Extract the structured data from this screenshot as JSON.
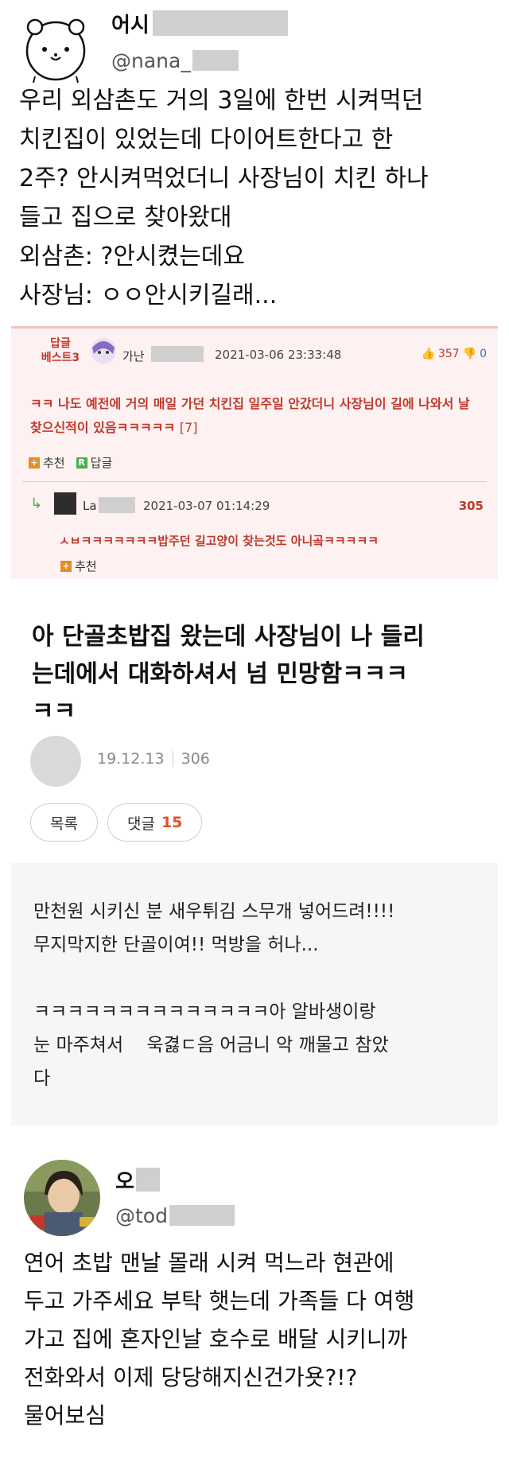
{
  "tweet1": {
    "name": "어시",
    "handle": "@nana_",
    "lines": [
      "우리 외삼촌도 거의 3일에 한번 시켜먹던",
      "치킨집이 있었는데 다이어트한다고 한",
      "2주? 안시켜먹었더니 사장님이 치킨 하나",
      "들고 집으로 찾아왔대",
      "외삼촌: ?안시켰는데요",
      "사장님: ㅇㅇ안시키길래..."
    ]
  },
  "comment": {
    "best_label": "답글\n베스트3",
    "author": "가난",
    "date": "2021-03-06 23:33:48",
    "likes": "357",
    "dislikes": "0",
    "text": "ㅋㅋ 나도 예전에 거의 매일 가던 치킨집 일주일 안갔더니 사장님이 길에 나와서 날 찾으신적이 있음ㅋㅋㅋㅋㅋ",
    "reply_count": "[7]",
    "recommend_label": "추천",
    "reply_label": "답글",
    "reply": {
      "author": "La",
      "date": "2021-03-07 01:14:29",
      "likes": "305",
      "text": "ㅅㅂㅋㅋㅋㅋㅋㅋㅋ밥주던 길고양이 찾는것도 아니곸ㅋㅋㅋㅋㅋ",
      "recommend_label": "추천"
    }
  },
  "post": {
    "title_lines": [
      "아 단골초밥집 왔는데 사장님이 나 들리",
      "는데에서 대화하셔서 넘 민망함ㅋㅋㅋ",
      "ㅋㅋ"
    ],
    "date": "19.12.13",
    "views": "306",
    "list_label": "목록",
    "comments_label": "댓글",
    "comments_count": "15"
  },
  "message": {
    "lines": [
      "만천원 시키신 분 새우튀김 스무개 넣어드려!!!!",
      "무지막지한 단골이여!! 먹방을 허나...",
      "",
      "ㅋㅋㅋㅋㅋㅋㅋㅋㅋㅋㅋㅋㅋㅋ아 알바생이랑",
      "눈 마주쳐서    욱겷ㄷ음 어금니 악 깨물고 참았",
      "다"
    ]
  },
  "tweet2": {
    "name": "오",
    "handle": "@tod",
    "lines": [
      "연어 초밥 맨날 몰래 시켜 먹느라 현관에",
      "두고 가주세요 부탁 햇는데 가족들 다 여행",
      "가고 집에 혼자인날 호수로 배달 시키니까",
      "전화와서 이제 당당해지신건가욧?!?",
      "물어보심"
    ]
  }
}
